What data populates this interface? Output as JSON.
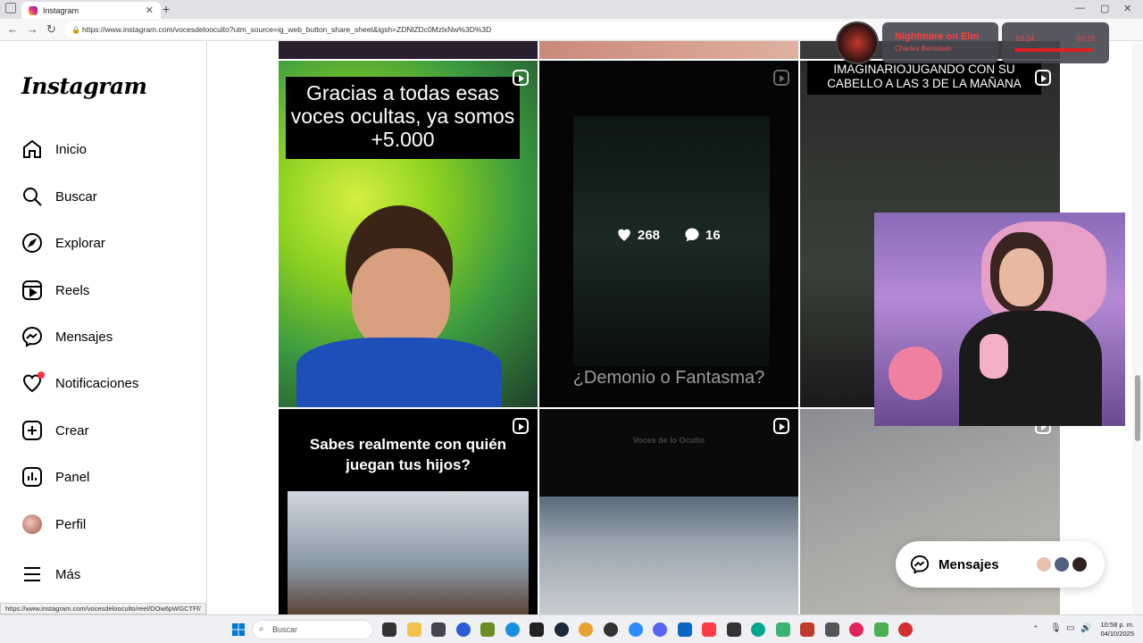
{
  "browser": {
    "tab_title": "Instagram",
    "url": "https://www.instagram.com/vocesdelooculto?utm_source=ig_web_button_share_sheet&igsh=ZDNlZDc0MzlxNw%3D%3D",
    "status_link": "https://www.instagram.com/vocesdelooculto/reel/DOw6pWGCTFf/"
  },
  "sidebar": {
    "logo": "Instagram",
    "items": [
      {
        "label": "Inicio",
        "icon": "home-icon"
      },
      {
        "label": "Buscar",
        "icon": "search-icon"
      },
      {
        "label": "Explorar",
        "icon": "compass-icon"
      },
      {
        "label": "Reels",
        "icon": "reels-icon"
      },
      {
        "label": "Mensajes",
        "icon": "messenger-icon"
      },
      {
        "label": "Notificaciones",
        "icon": "heart-icon"
      },
      {
        "label": "Crear",
        "icon": "plus-square-icon"
      },
      {
        "label": "Panel",
        "icon": "chart-icon"
      },
      {
        "label": "Perfil",
        "icon": "avatar"
      },
      {
        "label": "Más",
        "icon": "menu-icon"
      }
    ]
  },
  "posts": {
    "p1_caption": "Gracias a todas esas voces ocultas, ya somos +5.000",
    "p2_likes": "268",
    "p2_comments": "16",
    "p2_caption": "¿Demonio o Fantasma?",
    "p3_caption": "IMAGINARIOJUGANDO CON SU CABELLO A LAS 3 DE LA MAÑANA",
    "p4_caption": "Sabes realmente con quién juegan tus hijos?",
    "p5_watermark": "Voces de lo Oculto"
  },
  "player": {
    "title": "Nightmare on Elm",
    "artist": "Charles Bernstein",
    "elapsed": "03:24",
    "total": "03:33"
  },
  "messages_pill": {
    "label": "Mensajes"
  },
  "taskbar": {
    "search_placeholder": "Buscar",
    "time": "10:58 p. m.",
    "date": "04/10/2025"
  },
  "colors": {
    "notif_dot": "#ff3040",
    "player_red": "#ff3b3b"
  }
}
